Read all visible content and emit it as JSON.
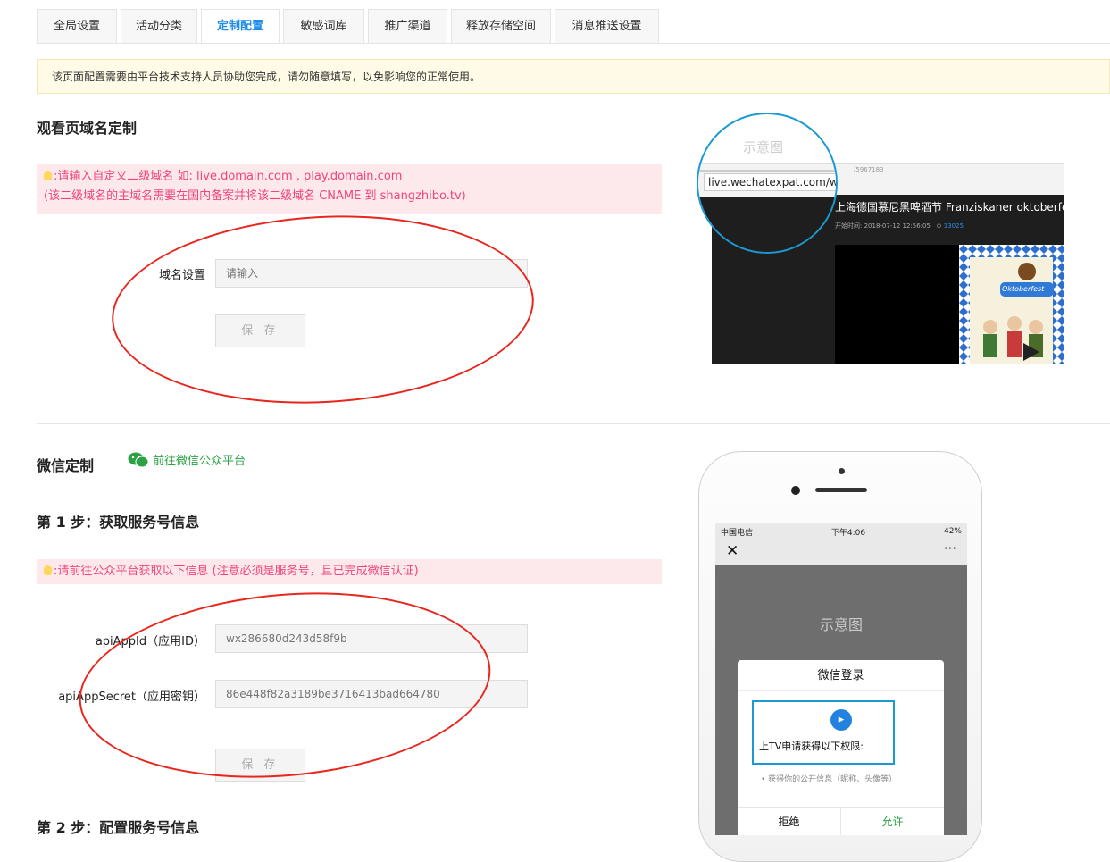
{
  "tabs": [
    {
      "label": "全局设置"
    },
    {
      "label": "活动分类"
    },
    {
      "label": "定制配置",
      "active": true
    },
    {
      "label": "敏感词库"
    },
    {
      "label": "推广渠道"
    },
    {
      "label": "释放存储空间"
    },
    {
      "label": "消息推送设置"
    }
  ],
  "notice": "该页面配置需要由平台技术支持人员协助您完成，请勿随意填写，以免影响您的正常使用。",
  "domain_section": {
    "title": "观看页域名定制",
    "tip_line1": ":请输入自定义二级域名 如: live.domain.com , play.domain.com",
    "tip_line2": "(该二级域名的主域名需要在国内备案并将该二级域名 CNAME 到 shangzhibo.tv)",
    "field_label": "域名设置",
    "field_placeholder": "请输入",
    "save": "保 存"
  },
  "preview1": {
    "caption": "示意图",
    "url": "live.wechatexpat.com/w",
    "url_suffix": "/5967183",
    "event_title": "上海德国慕尼黑啤酒节 Franziskaner oktoberfest",
    "start_label": "开始时间:",
    "start_time": "2018-07-12 12:56:05",
    "viewers": "13025",
    "poster_text": "Oktoberfest"
  },
  "wechat_section": {
    "title": "微信定制",
    "link": "前往微信公众平台",
    "step1": "第 1 步：获取服务号信息",
    "tip": ":请前往公众平台获取以下信息 (注意必须是服务号，且已完成微信认证)",
    "appid_label": "apiAppId（应用ID）",
    "appid_value": "wx286680d243d58f9b",
    "secret_label": "apiAppSecret（应用密钥）",
    "secret_value": "86e448f82a3189be3716413bad664780",
    "save": "保 存",
    "step2": "第 2 步：配置服务号信息"
  },
  "phone": {
    "carrier": "中国电信",
    "time": "下午4:06",
    "battery": "42%",
    "caption": "示意图",
    "dialog_title": "微信登录",
    "request": "上TV申请获得以下权限:",
    "permission": "获得你的公开信息（昵称、头像等）",
    "deny": "拒绝",
    "allow": "允许"
  },
  "colors": {
    "accent": "#1f8cea",
    "tip_text": "#f0447a",
    "wechat_green": "#2ba245",
    "annotation_red": "#e8261d",
    "annotation_blue": "#1b9ad2"
  }
}
